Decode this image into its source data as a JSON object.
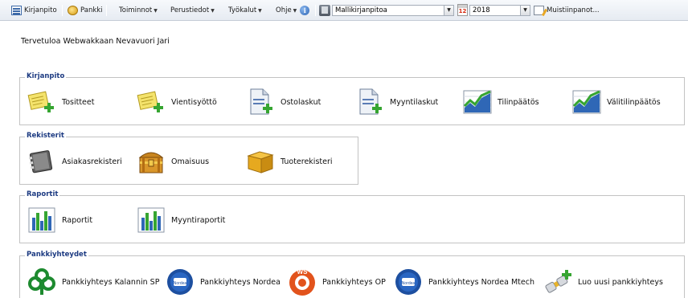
{
  "toolbar": {
    "kirjanpito": "Kirjanpito",
    "pankki": "Pankki",
    "toiminnot": "Toiminnot",
    "perustiedot": "Perustiedot",
    "tyokalut": "Työkalut",
    "ohje": "Ohje",
    "info_glyph": "i",
    "company_select": "Mallikirjanpitoa",
    "calendar_day": "12",
    "year_select": "2018",
    "memo": "Muistiinpanot..."
  },
  "welcome": "Tervetuloa Webwakkaan Nevavuori Jari",
  "groups": {
    "kirjanpito": {
      "legend": "Kirjanpito",
      "items": [
        "Tositteet",
        "Vientisyöttö",
        "Ostolaskut",
        "Myyntilaskut",
        "Tilinpäätös",
        "Välitilinpäätös"
      ]
    },
    "rekisterit": {
      "legend": "Rekisterit",
      "items": [
        "Asiakasrekisteri",
        "Omaisuus",
        "Tuoterekisteri"
      ]
    },
    "raportit": {
      "legend": "Raportit",
      "items": [
        "Raportit",
        "Myyntiraportit"
      ]
    },
    "pankkiyhteydet": {
      "legend": "Pankkiyhteydet",
      "items": [
        "Pankkiyhteys Kalannin SP",
        "Pankkiyhteys Nordea",
        "Pankkiyhteys OP",
        "Pankkiyhteys Nordea Mtech",
        "Luo uusi pankkiyhteys"
      ],
      "op_logo_text": "WS",
      "nordea_logo_text": "Nordea"
    }
  },
  "icons": {
    "kirjanpito": "journal-icon",
    "pankki": "coin-icon",
    "tositteet": "document-add-icon",
    "vientisyotto": "document-add-icon",
    "ostolaskut": "invoice-add-icon",
    "myyntilaskut": "invoice-add-icon",
    "tilinpaatos": "chart-trend-icon",
    "valitilinpaatos": "chart-trend-icon",
    "asiakasrekisteri": "address-book-icon",
    "omaisuus": "treasure-chest-icon",
    "tuoterekisteri": "product-box-icon",
    "raportit": "bar-chart-icon",
    "myyntiraportit": "bar-chart-icon",
    "kalannin": "savings-bank-icon",
    "nordea": "nordea-icon",
    "op": "op-bank-icon",
    "luo": "add-connection-icon"
  },
  "colors": {
    "legend_text": "#1d3b82",
    "group_border": "#c3c3c3",
    "toolbar_bg": "#e6ebf2",
    "green_accent": "#36a531",
    "op_orange": "#e2531c",
    "nordea_blue": "#1d4fa0"
  }
}
